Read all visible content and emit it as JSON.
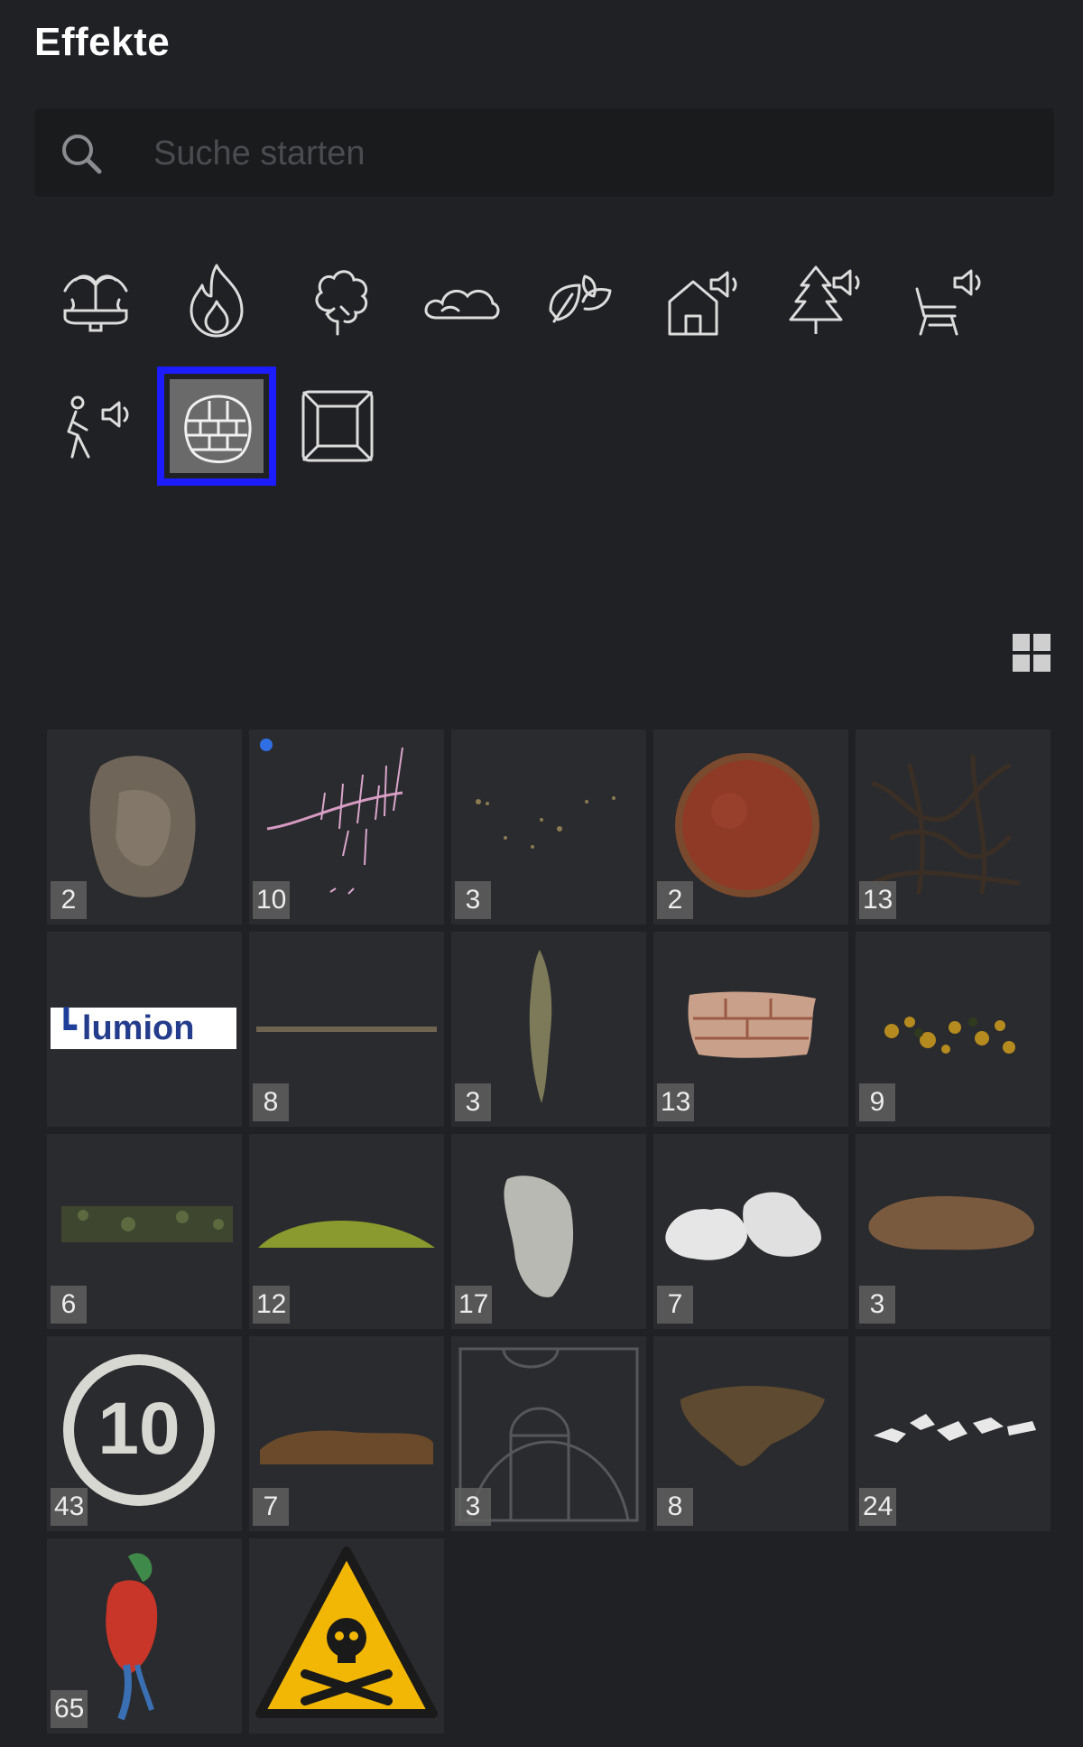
{
  "panel": {
    "title": "Effekte"
  },
  "search": {
    "placeholder": "Suche starten",
    "value": ""
  },
  "categories": [
    {
      "name": "fountain-icon",
      "selected": false
    },
    {
      "name": "fire-icon",
      "selected": false
    },
    {
      "name": "smoke-icon",
      "selected": false
    },
    {
      "name": "cloud-icon",
      "selected": false
    },
    {
      "name": "leaves-icon",
      "selected": false
    },
    {
      "name": "house-sound-icon",
      "selected": false
    },
    {
      "name": "tree-sound-icon",
      "selected": false
    },
    {
      "name": "chair-sound-icon",
      "selected": false
    },
    {
      "name": "person-sound-icon",
      "selected": false
    },
    {
      "name": "surface-decal-icon",
      "selected": true
    },
    {
      "name": "frame-icon",
      "selected": false
    }
  ],
  "view_toggle": {
    "icon": "grid-view-icon"
  },
  "library": {
    "items": [
      {
        "count": "2",
        "thumb": "brown-stone-blob"
      },
      {
        "count": "10",
        "thumb": "pink-sparks",
        "dot_color": "#2f6fe3"
      },
      {
        "count": "3",
        "thumb": "scattered-dots"
      },
      {
        "count": "2",
        "thumb": "red-round-stain"
      },
      {
        "count": "13",
        "thumb": "dark-cracks"
      },
      {
        "count": "",
        "thumb": "lumion-logo",
        "logo_text": "lumion"
      },
      {
        "count": "8",
        "thumb": "thin-line"
      },
      {
        "count": "3",
        "thumb": "vertical-debris"
      },
      {
        "count": "13",
        "thumb": "brick-patch"
      },
      {
        "count": "9",
        "thumb": "yellow-leaves"
      },
      {
        "count": "6",
        "thumb": "moss-strip"
      },
      {
        "count": "12",
        "thumb": "green-mound"
      },
      {
        "count": "17",
        "thumb": "white-smear"
      },
      {
        "count": "7",
        "thumb": "white-patches"
      },
      {
        "count": "3",
        "thumb": "brown-smear"
      },
      {
        "count": "43",
        "thumb": "speed-limit-sign",
        "sign_text": "10"
      },
      {
        "count": "7",
        "thumb": "dirt-strip"
      },
      {
        "count": "3",
        "thumb": "basketball-court-lines"
      },
      {
        "count": "8",
        "thumb": "mud-stain"
      },
      {
        "count": "24",
        "thumb": "white-flakes"
      },
      {
        "count": "65",
        "thumb": "parrot"
      },
      {
        "count": "",
        "thumb": "toxic-warning-sign"
      }
    ]
  }
}
